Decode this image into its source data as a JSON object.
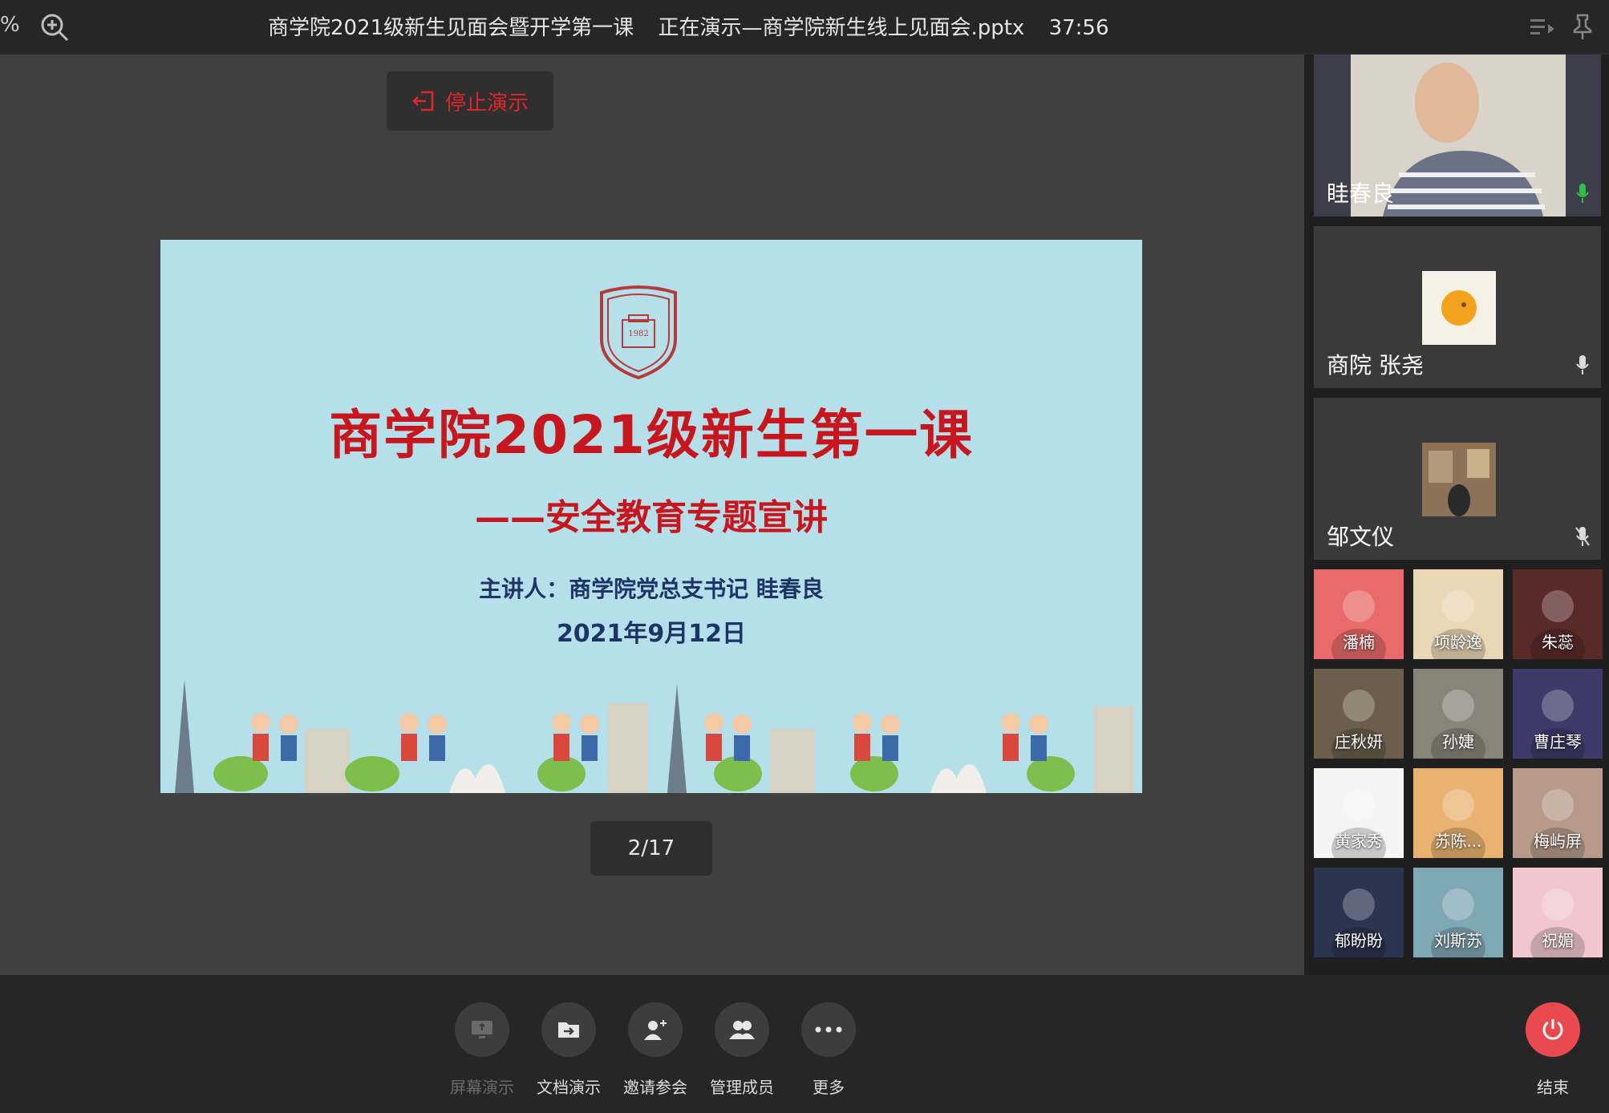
{
  "topbar": {
    "zoom_percent": "%",
    "meeting_title": "商学院2021级新生见面会暨开学第一课",
    "presenting_status": "正在演示—商学院新生线上见面会.pptx",
    "elapsed_time": "37:56"
  },
  "presentation": {
    "stop_label": "停止演示",
    "page_indicator": "2/17"
  },
  "slide": {
    "title": "商学院2021级新生第一课",
    "subtitle": "——安全教育专题宣讲",
    "presenter": "主讲人：商学院党总支书记 眭春良",
    "date": "2021年9月12日",
    "logo_year": "1982",
    "background_color": "#b5dfe9",
    "title_color": "#c7161d",
    "text_color": "#1c3566"
  },
  "video_tiles": [
    {
      "name": "眭春良",
      "mic": "active"
    },
    {
      "name": "商院 张尧",
      "mic": "on"
    },
    {
      "name": "邹文仪",
      "mic": "muted"
    }
  ],
  "participants": [
    {
      "name": "潘楠",
      "color": "#e86a6a"
    },
    {
      "name": "项龄逸",
      "color": "#e9d7b5"
    },
    {
      "name": "朱蕊",
      "color": "#5a2a2a"
    },
    {
      "name": "庄秋妍",
      "color": "#6b5f4c"
    },
    {
      "name": "孙婕",
      "color": "#8a8378"
    },
    {
      "name": "曹庄琴",
      "color": "#3f3a6a"
    },
    {
      "name": "黄家秀",
      "color": "#f4f4f4"
    },
    {
      "name": "苏陈...",
      "color": "#e9b271"
    },
    {
      "name": "梅屿屏",
      "color": "#b79a8a"
    },
    {
      "name": "郁盼盼",
      "color": "#2c3550"
    },
    {
      "name": "刘斯苏",
      "color": "#7fa8b5"
    },
    {
      "name": "祝媚",
      "color": "#f1c6cf"
    }
  ],
  "toolbar": {
    "screen_share_label": "屏幕演示",
    "doc_share_label": "文档演示",
    "invite_label": "邀请参会",
    "manage_label": "管理成员",
    "more_label": "更多",
    "end_label": "结束"
  },
  "colors": {
    "accent_red": "#e94a4f",
    "mic_active": "#2ec04a"
  }
}
